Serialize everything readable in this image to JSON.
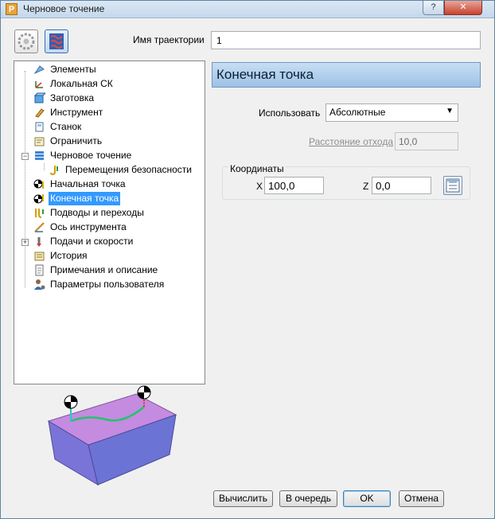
{
  "window": {
    "title": "Черновое точение",
    "app_icon_letter": "P",
    "help_label": "?",
    "close_label": "✕"
  },
  "toolbar": {
    "button1_icon": "curve-gear-icon",
    "button2_icon": "pattern-icon"
  },
  "trajectory": {
    "label": "Имя траектории",
    "value": "1"
  },
  "tree": {
    "items": [
      {
        "label": "Элементы",
        "icon": "elements-icon"
      },
      {
        "label": "Локальная СК",
        "icon": "local-cs-icon"
      },
      {
        "label": "Заготовка",
        "icon": "stock-icon"
      },
      {
        "label": "Инструмент",
        "icon": "tool-icon"
      },
      {
        "label": "Станок",
        "icon": "machine-icon"
      },
      {
        "label": "Ограничить",
        "icon": "limit-icon"
      },
      {
        "label": "Черновое точение",
        "icon": "rough-turning-icon"
      },
      {
        "label": "Перемещения безопасности",
        "icon": "safety-moves-icon"
      },
      {
        "label": "Начальная точка",
        "icon": "start-point-icon"
      },
      {
        "label": "Конечная точка",
        "icon": "end-point-icon",
        "selected": true
      },
      {
        "label": "Подводы и переходы",
        "icon": "leads-links-icon"
      },
      {
        "label": "Ось инструмента",
        "icon": "tool-axis-icon"
      },
      {
        "label": "Подачи и скорости",
        "icon": "feeds-speeds-icon"
      },
      {
        "label": "История",
        "icon": "history-icon"
      },
      {
        "label": "Примечания и описание",
        "icon": "notes-icon"
      },
      {
        "label": "Параметры пользователя",
        "icon": "user-params-icon"
      }
    ]
  },
  "panel": {
    "header": "Конечная точка",
    "use_label": "Использовать",
    "use_value": "Абсолютные",
    "distance_label": "Расстояние отхода",
    "distance_value": "10,0",
    "coords_title": "Координаты",
    "x_label": "X",
    "x_value": "100,0",
    "z_label": "Z",
    "z_value": "0,0"
  },
  "buttons": {
    "calculate": "Вычислить",
    "queue": "В очередь",
    "ok": "OK",
    "cancel": "Отмена"
  },
  "colors": {
    "selection": "#3399ff",
    "block_top": "#c48be0",
    "block_side": "#6b73d4",
    "toolpath": "#22c46b"
  }
}
